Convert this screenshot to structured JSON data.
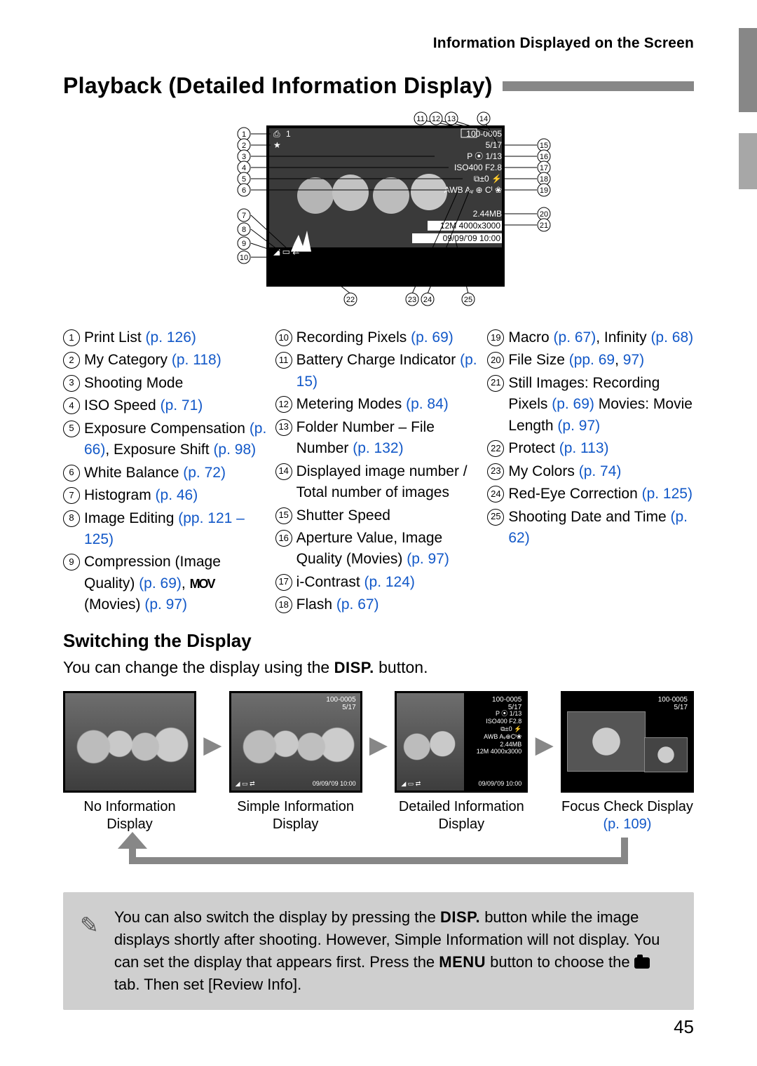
{
  "running_head": "Information Displayed on the Screen",
  "title": "Playback (Detailed Information Display)",
  "figure_overlay": {
    "top_left_battery": "▮",
    "top_left_num": "1",
    "folder_file": "100-0005",
    "count": "5/17",
    "mode_row": "P ⦿   1/13",
    "iso_f": "ISO400   F2.8",
    "ev_flash": "⧉±0 ⚡",
    "wb_row": "AWB Aᵥ ⊕ Cᴵ ❀",
    "filesize": "2.44MB",
    "res": "12M 4000x3000",
    "date": "09/09/'09 10:00",
    "hist_icons": "◢ ▭ ⇄"
  },
  "callouts_top": [
    "11",
    "12",
    "13",
    "14"
  ],
  "callouts_right": [
    "15",
    "16",
    "17",
    "18",
    "19",
    "20",
    "21"
  ],
  "callouts_left": [
    "1",
    "2",
    "3",
    "4",
    "5",
    "6",
    "7",
    "8",
    "9",
    "10"
  ],
  "callouts_bottom": [
    "22",
    "23",
    "24",
    "25"
  ],
  "legend": {
    "col1": [
      {
        "n": "1",
        "parts": [
          {
            "t": "Print List "
          },
          {
            "ref": "(p. 126)"
          }
        ]
      },
      {
        "n": "2",
        "parts": [
          {
            "t": "My Category "
          },
          {
            "ref": "(p. 118)"
          }
        ]
      },
      {
        "n": "3",
        "parts": [
          {
            "t": "Shooting Mode"
          }
        ]
      },
      {
        "n": "4",
        "parts": [
          {
            "t": "ISO Speed "
          },
          {
            "ref": "(p. 71)"
          }
        ]
      },
      {
        "n": "5",
        "parts": [
          {
            "t": "Exposure Compensation "
          },
          {
            "ref": "(p. 66)"
          },
          {
            "t": ", Exposure Shift "
          },
          {
            "ref": "(p. 98)"
          }
        ]
      },
      {
        "n": "6",
        "parts": [
          {
            "t": "White Balance "
          },
          {
            "ref": "(p. 72)"
          }
        ]
      },
      {
        "n": "7",
        "parts": [
          {
            "t": "Histogram "
          },
          {
            "ref": "(p. 46)"
          }
        ]
      },
      {
        "n": "8",
        "parts": [
          {
            "t": "Image Editing "
          },
          {
            "ref": "(pp. 121 – 125)"
          }
        ]
      },
      {
        "n": "9",
        "parts": [
          {
            "t": "Compression (Image Quality) "
          },
          {
            "ref": "(p. 69)"
          },
          {
            "t": ", "
          },
          {
            "mov": true
          },
          {
            "t": " (Movies) "
          },
          {
            "ref": "(p. 97)"
          }
        ]
      }
    ],
    "col2": [
      {
        "n": "10",
        "parts": [
          {
            "t": "Recording Pixels "
          },
          {
            "ref": "(p. 69)"
          }
        ]
      },
      {
        "n": "11",
        "parts": [
          {
            "t": "Battery Charge Indicator "
          },
          {
            "ref": "(p. 15)"
          }
        ]
      },
      {
        "n": "12",
        "parts": [
          {
            "t": "Metering Modes "
          },
          {
            "ref": "(p. 84)"
          }
        ]
      },
      {
        "n": "13",
        "parts": [
          {
            "t": "Folder Number – File Number "
          },
          {
            "ref": "(p. 132)"
          }
        ]
      },
      {
        "n": "14",
        "parts": [
          {
            "t": "Displayed image number / Total number of images"
          }
        ]
      },
      {
        "n": "15",
        "parts": [
          {
            "t": "Shutter Speed"
          }
        ]
      },
      {
        "n": "16",
        "parts": [
          {
            "t": "Aperture Value, Image Quality (Movies) "
          },
          {
            "ref": "(p. 97)"
          }
        ]
      },
      {
        "n": "17",
        "parts": [
          {
            "t": "i-Contrast "
          },
          {
            "ref": "(p. 124)"
          }
        ]
      },
      {
        "n": "18",
        "parts": [
          {
            "t": "Flash "
          },
          {
            "ref": "(p. 67)"
          }
        ]
      }
    ],
    "col3": [
      {
        "n": "19",
        "parts": [
          {
            "t": "Macro "
          },
          {
            "ref": "(p. 67)"
          },
          {
            "t": ", Infinity "
          },
          {
            "ref": "(p. 68)"
          }
        ]
      },
      {
        "n": "20",
        "parts": [
          {
            "t": "File Size "
          },
          {
            "ref": "(pp. 69"
          },
          {
            "t": ", "
          },
          {
            "ref": "97)"
          }
        ]
      },
      {
        "n": "21",
        "parts": [
          {
            "t": "Still Images: Recording Pixels "
          },
          {
            "ref": "(p. 69)"
          },
          {
            "t": " Movies: Movie Length "
          },
          {
            "ref": "(p. 97)"
          }
        ]
      },
      {
        "n": "22",
        "parts": [
          {
            "t": "Protect "
          },
          {
            "ref": "(p. 113)"
          }
        ]
      },
      {
        "n": "23",
        "parts": [
          {
            "t": "My Colors "
          },
          {
            "ref": "(p. 74)"
          }
        ]
      },
      {
        "n": "24",
        "parts": [
          {
            "t": "Red-Eye Correction "
          },
          {
            "ref": "(p. 125)"
          }
        ]
      },
      {
        "n": "25",
        "parts": [
          {
            "t": "Shooting Date and Time "
          },
          {
            "ref": "(p. 62)"
          }
        ]
      }
    ]
  },
  "switching": {
    "heading": "Switching the Display",
    "body_pre": "You can change the display using the ",
    "disp": "DISP.",
    "body_post": " button."
  },
  "thumbs": [
    {
      "label": "No Information Display",
      "overlay": "none"
    },
    {
      "label": "Simple Information Display",
      "overlay": "simple"
    },
    {
      "label": "Detailed Information Display",
      "overlay": "detailed"
    },
    {
      "label": "Focus Check Display",
      "overlay": "focus",
      "ref": "(p. 109)"
    }
  ],
  "thumb_overlay": {
    "folder": "100-0005",
    "count": "5/17",
    "mode": "P ⦿  1/13",
    "iso": "ISO400  F2.8",
    "ev": "⧉±0 ⚡",
    "wb": "AWB Aᵥ⊕Cᴵ❀",
    "size": "2.44MB",
    "res": "12M 4000x3000",
    "date": "09/09/'09  10:00",
    "icons": "◢ ▭ ⇄"
  },
  "note": {
    "pre": "You can also switch the display by pressing the ",
    "disp": "DISP.",
    "mid1": " button while the image displays shortly after shooting. However, Simple Information will not display. You can set the display that appears first. Press the ",
    "menu": "MENU",
    "mid2": " button to choose the ",
    "mid3": " tab. Then set [Review Info]."
  },
  "page_number": "45"
}
